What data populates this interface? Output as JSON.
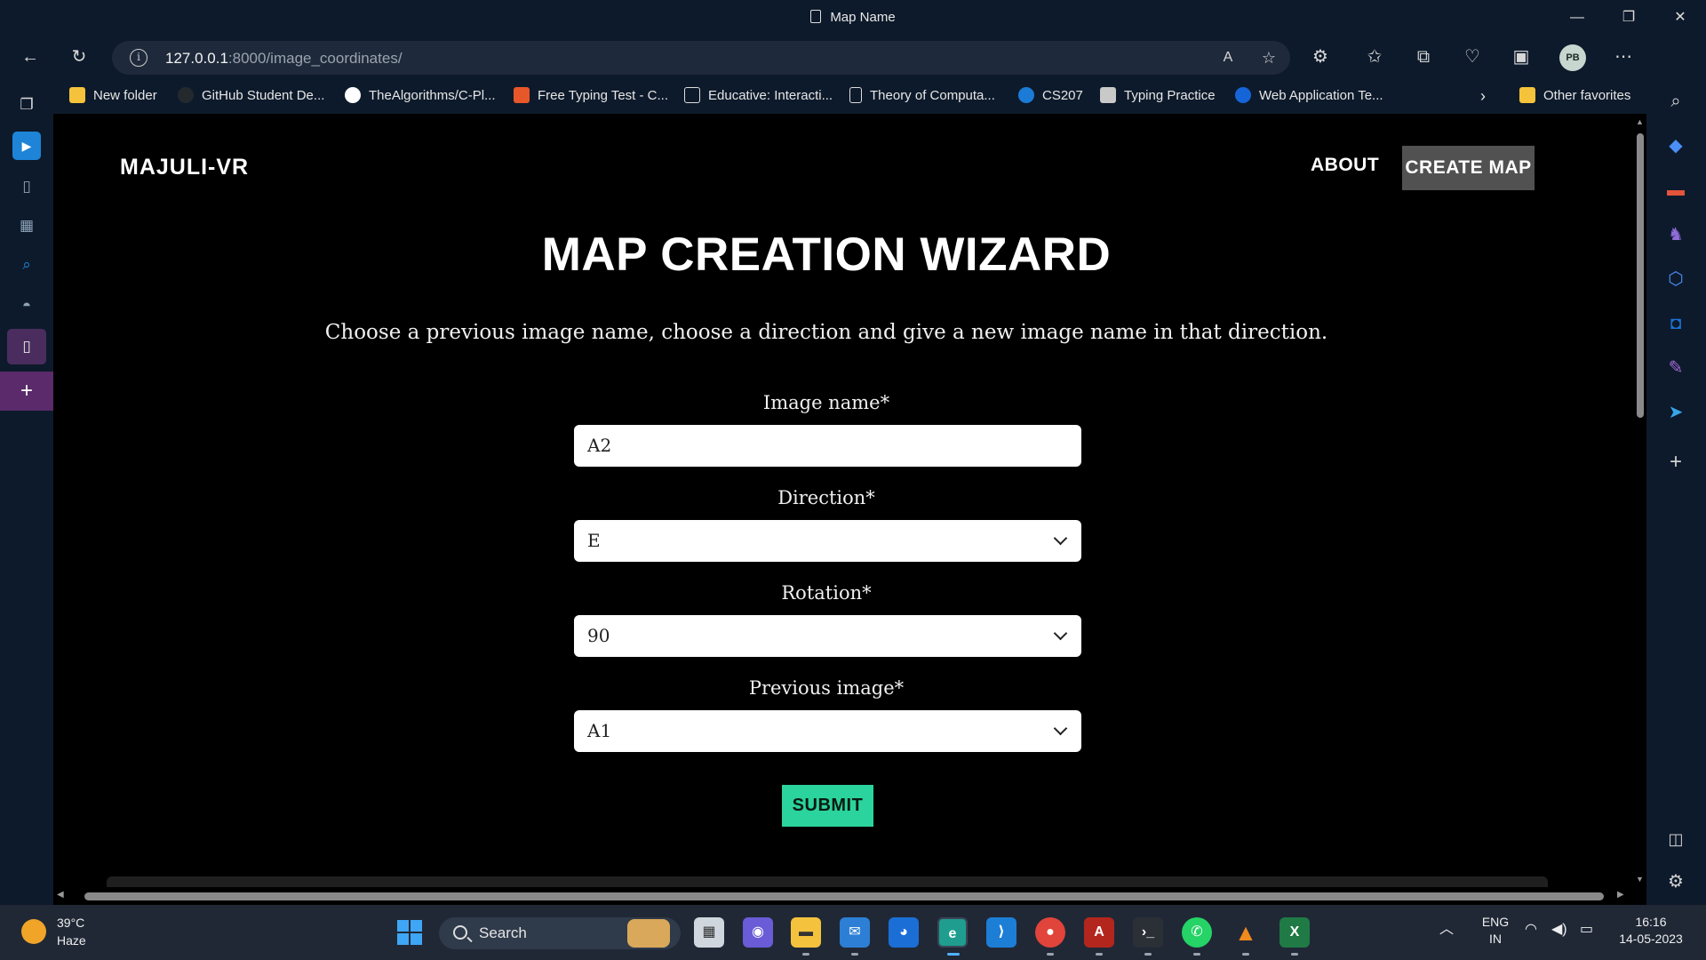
{
  "window": {
    "title": "Map Name"
  },
  "toolbar": {
    "url_host": "127.0.0.1",
    "url_rest": ":8000/image_coordinates/",
    "profile_initials": "PB"
  },
  "favorites": [
    {
      "label": "New folder",
      "color": "#f5c33b"
    },
    {
      "label": "GitHub Student De...",
      "color": "#24292e"
    },
    {
      "label": "TheAlgorithms/C-Pl...",
      "color": "#ffffff"
    },
    {
      "label": "Free Typing Test - C...",
      "color": "#e8572a"
    },
    {
      "label": "Educative: Interacti...",
      "color": "#1b1b2f"
    },
    {
      "label": "Theory of Computa...",
      "color": "#0d1a2b"
    },
    {
      "label": "CS207",
      "color": "#1b7bd6"
    },
    {
      "label": "Typing Practice",
      "color": "#c9c9c9"
    },
    {
      "label": "Web Application Te...",
      "color": "#1565d8"
    },
    {
      "label": "Other favorites",
      "color": "#f5c33b"
    }
  ],
  "site": {
    "brand": "MAJULI-VR",
    "nav_about": "ABOUT",
    "nav_create": "CREATE MAP"
  },
  "page": {
    "title": "MAP CREATION WIZARD",
    "description": "Choose a previous image name, choose a direction and give a new image name in that direction."
  },
  "form": {
    "image_name_label": "Image name*",
    "image_name_value": "A2",
    "direction_label": "Direction*",
    "direction_value": "E",
    "rotation_label": "Rotation*",
    "rotation_value": "90",
    "previous_label": "Previous image*",
    "previous_value": "A1",
    "submit_label": "SUBMIT",
    "submit_color": "#2bd49c"
  },
  "taskbar": {
    "temperature": "39°C",
    "weather": "Haze",
    "search_label": "Search",
    "lang1": "ENG",
    "lang2": "IN",
    "time": "16:16",
    "date": "14-05-2023"
  }
}
